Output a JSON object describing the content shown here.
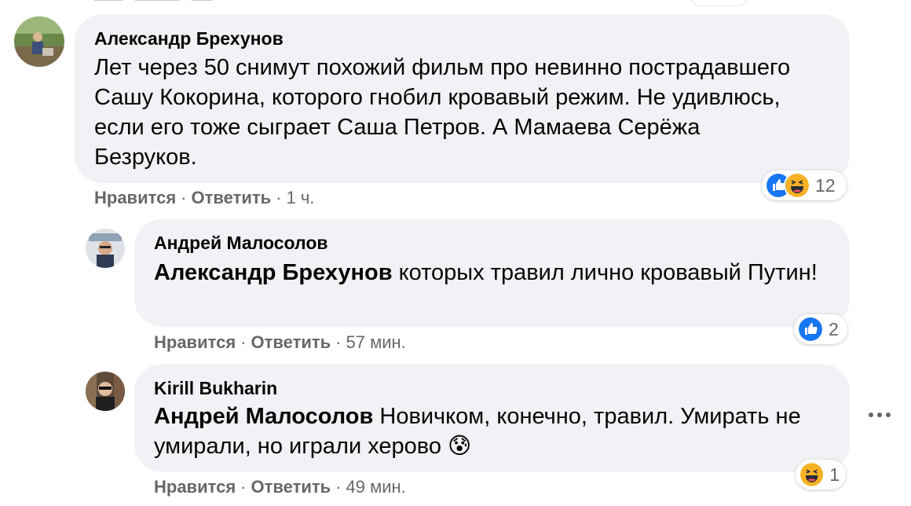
{
  "comments": [
    {
      "author": "Александр Брехунов",
      "text": "Лет через 50 снимут похожий фильм про невинно пострадавшего Сашу Кокорина, которого гнобил кровавый режим. Не удивлюсь, если его тоже сыграет Саша Петров. А Мамаева Серёжа Безруков.",
      "like_label": "Нравится",
      "reply_label": "Ответить",
      "time": "1 ч.",
      "reaction_icons": [
        "like-icon",
        "haha-icon"
      ],
      "reaction_count": "12"
    },
    {
      "author": "Андрей Малосолов",
      "mention": "Александр Брехунов",
      "text": "которых травил лично кровавый Путин!",
      "like_label": "Нравится",
      "reply_label": "Ответить",
      "time": "57 мин.",
      "reaction_icons": [
        "like-icon"
      ],
      "reaction_count": "2"
    },
    {
      "author": "Kirill Bukharin",
      "mention": "Андрей Малосолов",
      "text": "Новичком, конечно, травил. Умирать не умирали, но играли херово",
      "emoji": "😰",
      "like_label": "Нравится",
      "reply_label": "Ответить",
      "time": "49 мин.",
      "reaction_icons": [
        "haha-icon"
      ],
      "reaction_count": "1"
    }
  ],
  "separator": "·",
  "colors": {
    "bubble": "#f0f2f5",
    "secondary_text": "#65676b",
    "like_blue": "#1877f2",
    "haha_yellow": "#f7b125"
  }
}
